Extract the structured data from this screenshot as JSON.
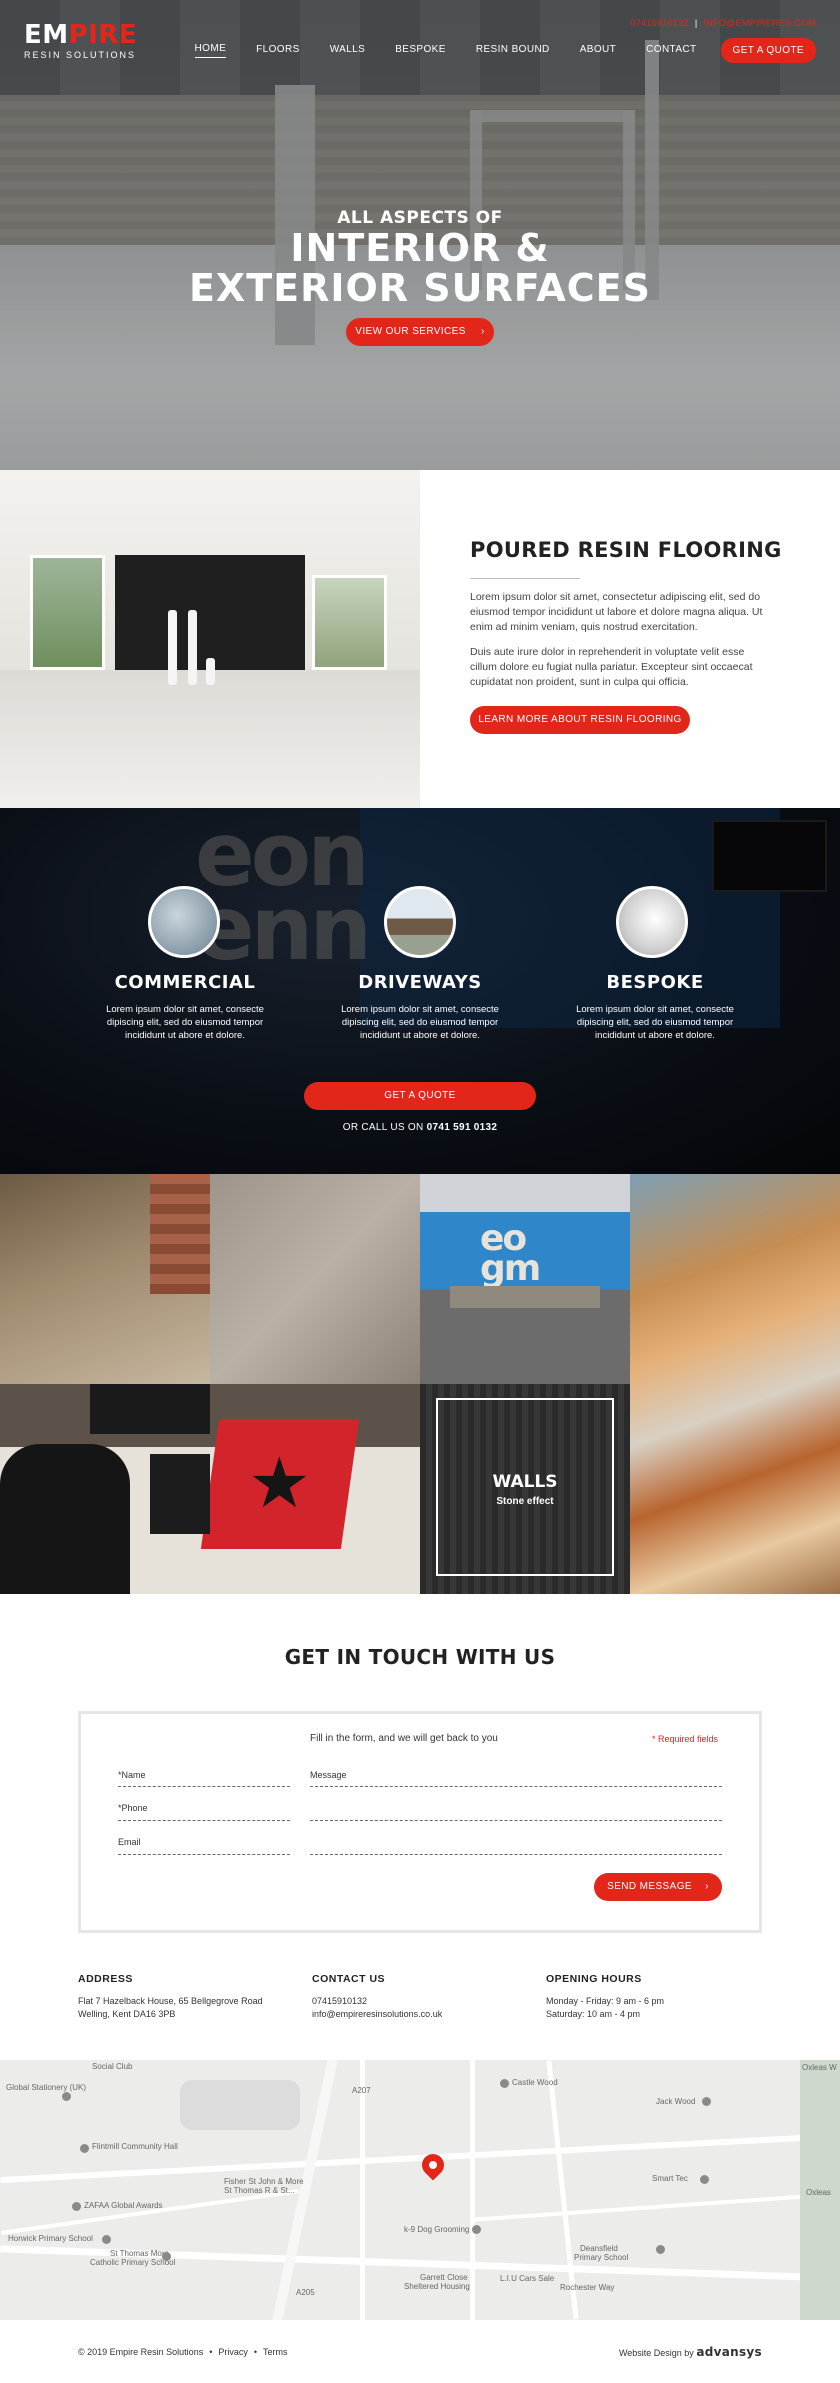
{
  "header": {
    "logo_main_a": "EM",
    "logo_main_b": "PIRE",
    "logo_sub": "RESIN SOLUTIONS",
    "phone": "07415910132",
    "email": "INFO@EMPIRERES.COM",
    "nav": [
      "HOME",
      "FLOORS",
      "WALLS",
      "BESPOKE",
      "RESIN BOUND",
      "ABOUT",
      "CONTACT"
    ],
    "quote_label": "GET A QUOTE"
  },
  "hero": {
    "kicker": "ALL ASPECTS OF",
    "title_line1": "INTERIOR &",
    "title_line2": "EXTERIOR SURFACES",
    "button": "VIEW OUR SERVICES"
  },
  "poured": {
    "title": "POURED RESIN FLOORING",
    "p1": "Lorem ipsum dolor sit amet, consectetur adipiscing elit, sed do eiusmod tempor incididunt ut labore et dolore magna aliqua. Ut enim ad minim veniam, quis nostrud exercitation.",
    "p2": "Duis aute irure dolor in reprehenderit in voluptate velit esse cillum dolore eu fugiat nulla pariatur. Excepteur sint occaecat cupidatat non proident, sunt in culpa qui officia.",
    "button": "LEARN MORE ABOUT RESIN FLOORING"
  },
  "services": {
    "items": [
      {
        "title": "COMMERCIAL",
        "text": "Lorem ipsum dolor sit amet, consecte dipiscing elit, sed do eiusmod tempor incididunt ut abore et dolore."
      },
      {
        "title": "DRIVEWAYS",
        "text": "Lorem ipsum dolor sit amet, consecte dipiscing elit, sed do eiusmod tempor incididunt ut abore et dolore."
      },
      {
        "title": "BESPOKE",
        "text": "Lorem ipsum dolor sit amet, consecte dipiscing elit, sed do eiusmod tempor incididunt ut abore et dolore."
      }
    ],
    "button": "GET A QUOTE",
    "call_prefix": "OR CALL US ON",
    "call_number": "0741 591 0132"
  },
  "gallery": {
    "walls_title": "WALLS",
    "walls_sub": "Stone effect"
  },
  "contact": {
    "title": "GET IN TOUCH WITH US",
    "intro": "Fill in the form, and we will get back to you",
    "required": "* Required fields",
    "name_label": "*Name",
    "phone_label": "*Phone",
    "email_label": "Email",
    "message_label": "Message",
    "send_label": "SEND MESSAGE"
  },
  "info": {
    "address_head": "ADDRESS",
    "address_1": "Flat 7 Hazelback House, 65 Bellgegrove Road",
    "address_2": "Welling, Kent DA16 3PB",
    "contact_head": "CONTACT US",
    "contact_phone": "07415910132",
    "contact_email": "info@empireresinsolutions.co.uk",
    "hours_head": "OPENING HOURS",
    "hours_1": "Monday - Friday: 9 am - 6 pm",
    "hours_2": "Saturday: 10 am - 4 pm"
  },
  "map": {
    "labels": [
      "Global Stationery (UK)",
      "Social Club",
      "Castle Wood",
      "Oxleas W",
      "Jack Wood",
      "Flintmill Community Hall",
      "Fisher St John & More",
      "St Thomas R & St...",
      "ZAFAA Global Awards",
      "Smart Tec",
      "Oxleas",
      "Horwick Primary School",
      "St Thomas More",
      "Catholic Primary School",
      "k-9 Dog Grooming",
      "Deansfield",
      "Primary School",
      "Garrett Close",
      "Sheltered Housing",
      "L.I.U Cars Sale",
      "Rochester Way",
      "A205",
      "A207"
    ]
  },
  "footer": {
    "copyright": "© 2019 Empire Resin Solutions",
    "privacy": "Privacy",
    "terms": "Terms",
    "credit_prefix": "Website Design by",
    "credit_brand": "advansys"
  },
  "colors": {
    "accent": "#e3261a",
    "dark_text": "#222222"
  }
}
